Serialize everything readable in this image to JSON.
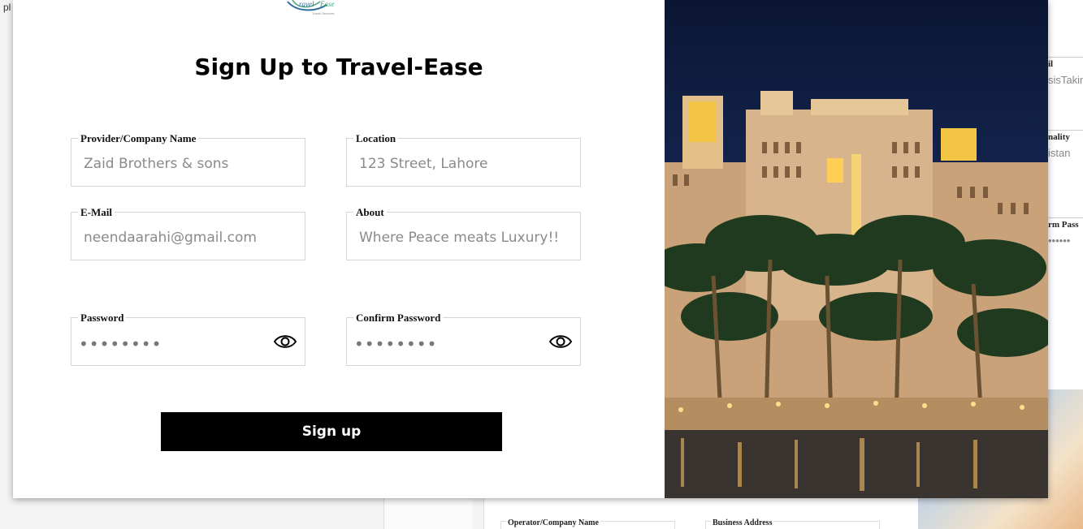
{
  "background": {
    "corner_text": "pl",
    "right_fields": [
      {
        "label": "il",
        "value": "sisTakin"
      },
      {
        "label": "nality",
        "value": "istan"
      },
      {
        "label": "rm Pass",
        "value": "••••••"
      }
    ],
    "bottom_fields": [
      "Operator/Company Name",
      "Business Address"
    ]
  },
  "modal": {
    "title": "Sign Up to Travel-Ease",
    "logo_text": "TravelEase",
    "fields": {
      "company": {
        "label": "Provider/Company Name",
        "value": "Zaid Brothers & sons"
      },
      "location": {
        "label": "Location",
        "value": "123 Street, Lahore"
      },
      "email": {
        "label": "E-Mail",
        "value": "neendaarahi@gmail.com"
      },
      "about": {
        "label": "About",
        "value": "Where Peace meats Luxury!!"
      },
      "password": {
        "label": "Password",
        "value": "••••••••"
      },
      "confirm_password": {
        "label": "Confirm Password",
        "value": "••••••••"
      }
    },
    "signup_label": "Sign up"
  },
  "colors": {
    "button_bg": "#000000",
    "field_text": "#8a8a8a",
    "field_border": "#d6d6d6"
  }
}
